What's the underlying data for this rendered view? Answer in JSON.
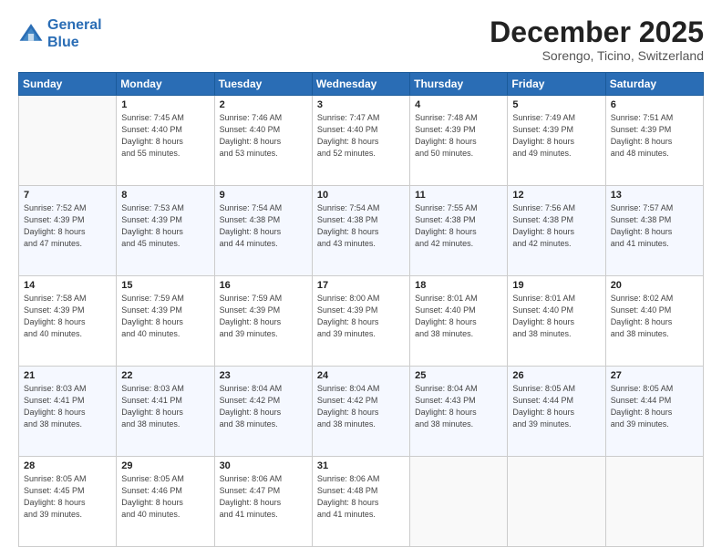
{
  "logo": {
    "line1": "General",
    "line2": "Blue"
  },
  "header": {
    "month": "December 2025",
    "location": "Sorengo, Ticino, Switzerland"
  },
  "weekdays": [
    "Sunday",
    "Monday",
    "Tuesday",
    "Wednesday",
    "Thursday",
    "Friday",
    "Saturday"
  ],
  "weeks": [
    [
      {
        "day": "",
        "info": ""
      },
      {
        "day": "1",
        "info": "Sunrise: 7:45 AM\nSunset: 4:40 PM\nDaylight: 8 hours\nand 55 minutes."
      },
      {
        "day": "2",
        "info": "Sunrise: 7:46 AM\nSunset: 4:40 PM\nDaylight: 8 hours\nand 53 minutes."
      },
      {
        "day": "3",
        "info": "Sunrise: 7:47 AM\nSunset: 4:40 PM\nDaylight: 8 hours\nand 52 minutes."
      },
      {
        "day": "4",
        "info": "Sunrise: 7:48 AM\nSunset: 4:39 PM\nDaylight: 8 hours\nand 50 minutes."
      },
      {
        "day": "5",
        "info": "Sunrise: 7:49 AM\nSunset: 4:39 PM\nDaylight: 8 hours\nand 49 minutes."
      },
      {
        "day": "6",
        "info": "Sunrise: 7:51 AM\nSunset: 4:39 PM\nDaylight: 8 hours\nand 48 minutes."
      }
    ],
    [
      {
        "day": "7",
        "info": "Sunrise: 7:52 AM\nSunset: 4:39 PM\nDaylight: 8 hours\nand 47 minutes."
      },
      {
        "day": "8",
        "info": "Sunrise: 7:53 AM\nSunset: 4:39 PM\nDaylight: 8 hours\nand 45 minutes."
      },
      {
        "day": "9",
        "info": "Sunrise: 7:54 AM\nSunset: 4:38 PM\nDaylight: 8 hours\nand 44 minutes."
      },
      {
        "day": "10",
        "info": "Sunrise: 7:54 AM\nSunset: 4:38 PM\nDaylight: 8 hours\nand 43 minutes."
      },
      {
        "day": "11",
        "info": "Sunrise: 7:55 AM\nSunset: 4:38 PM\nDaylight: 8 hours\nand 42 minutes."
      },
      {
        "day": "12",
        "info": "Sunrise: 7:56 AM\nSunset: 4:38 PM\nDaylight: 8 hours\nand 42 minutes."
      },
      {
        "day": "13",
        "info": "Sunrise: 7:57 AM\nSunset: 4:38 PM\nDaylight: 8 hours\nand 41 minutes."
      }
    ],
    [
      {
        "day": "14",
        "info": "Sunrise: 7:58 AM\nSunset: 4:39 PM\nDaylight: 8 hours\nand 40 minutes."
      },
      {
        "day": "15",
        "info": "Sunrise: 7:59 AM\nSunset: 4:39 PM\nDaylight: 8 hours\nand 40 minutes."
      },
      {
        "day": "16",
        "info": "Sunrise: 7:59 AM\nSunset: 4:39 PM\nDaylight: 8 hours\nand 39 minutes."
      },
      {
        "day": "17",
        "info": "Sunrise: 8:00 AM\nSunset: 4:39 PM\nDaylight: 8 hours\nand 39 minutes."
      },
      {
        "day": "18",
        "info": "Sunrise: 8:01 AM\nSunset: 4:40 PM\nDaylight: 8 hours\nand 38 minutes."
      },
      {
        "day": "19",
        "info": "Sunrise: 8:01 AM\nSunset: 4:40 PM\nDaylight: 8 hours\nand 38 minutes."
      },
      {
        "day": "20",
        "info": "Sunrise: 8:02 AM\nSunset: 4:40 PM\nDaylight: 8 hours\nand 38 minutes."
      }
    ],
    [
      {
        "day": "21",
        "info": "Sunrise: 8:03 AM\nSunset: 4:41 PM\nDaylight: 8 hours\nand 38 minutes."
      },
      {
        "day": "22",
        "info": "Sunrise: 8:03 AM\nSunset: 4:41 PM\nDaylight: 8 hours\nand 38 minutes."
      },
      {
        "day": "23",
        "info": "Sunrise: 8:04 AM\nSunset: 4:42 PM\nDaylight: 8 hours\nand 38 minutes."
      },
      {
        "day": "24",
        "info": "Sunrise: 8:04 AM\nSunset: 4:42 PM\nDaylight: 8 hours\nand 38 minutes."
      },
      {
        "day": "25",
        "info": "Sunrise: 8:04 AM\nSunset: 4:43 PM\nDaylight: 8 hours\nand 38 minutes."
      },
      {
        "day": "26",
        "info": "Sunrise: 8:05 AM\nSunset: 4:44 PM\nDaylight: 8 hours\nand 39 minutes."
      },
      {
        "day": "27",
        "info": "Sunrise: 8:05 AM\nSunset: 4:44 PM\nDaylight: 8 hours\nand 39 minutes."
      }
    ],
    [
      {
        "day": "28",
        "info": "Sunrise: 8:05 AM\nSunset: 4:45 PM\nDaylight: 8 hours\nand 39 minutes."
      },
      {
        "day": "29",
        "info": "Sunrise: 8:05 AM\nSunset: 4:46 PM\nDaylight: 8 hours\nand 40 minutes."
      },
      {
        "day": "30",
        "info": "Sunrise: 8:06 AM\nSunset: 4:47 PM\nDaylight: 8 hours\nand 41 minutes."
      },
      {
        "day": "31",
        "info": "Sunrise: 8:06 AM\nSunset: 4:48 PM\nDaylight: 8 hours\nand 41 minutes."
      },
      {
        "day": "",
        "info": ""
      },
      {
        "day": "",
        "info": ""
      },
      {
        "day": "",
        "info": ""
      }
    ]
  ]
}
